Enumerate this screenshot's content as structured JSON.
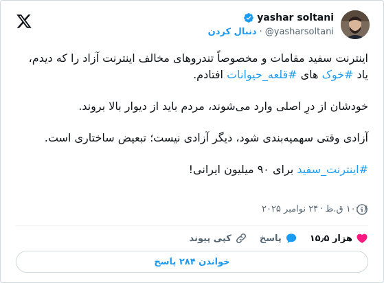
{
  "header": {
    "display_name": "yashar soltani",
    "handle": "@yasharsoltani",
    "follow_label": "دنبال کردن",
    "dot": "·"
  },
  "tweet": {
    "p1_part1": "اینترنت سفید مقامات و مخصوصاً تندروهای مخالف اینترنت آزاد را که دیدم، یاد ",
    "p1_tag1": "#خوک",
    "p1_part2": " های ",
    "p1_tag2": "#قلعه_حیوانات",
    "p1_part3": " افتادم.",
    "p2": "خودشان از درِ اصلی وارد می‌شوند، مردم باید از دیوار بالا بروند.",
    "p3": "آزادی وقتی سهمیه‌بندی شود، دیگر آزادی نیست؛ تبعیض ساختاری است.",
    "p4_tag": "#اینترنت_سفید",
    "p4_rest": " برای ۹۰ میلیون ایرانی!"
  },
  "meta": {
    "time": "۱۰:۰۶ ق.ظ",
    "separator": "·",
    "date": "۲۴ نوامبر ۲۰۲۵"
  },
  "actions": {
    "likes": "۱۵٫۵ هزار",
    "reply": "پاسخ",
    "copy_link": "کپی پیوند"
  },
  "read_replies": "خواندن ۲۸۴ پاسخ",
  "colors": {
    "accent": "#1d9bf0",
    "like_red": "#f91880",
    "secondary_text": "#536471"
  }
}
